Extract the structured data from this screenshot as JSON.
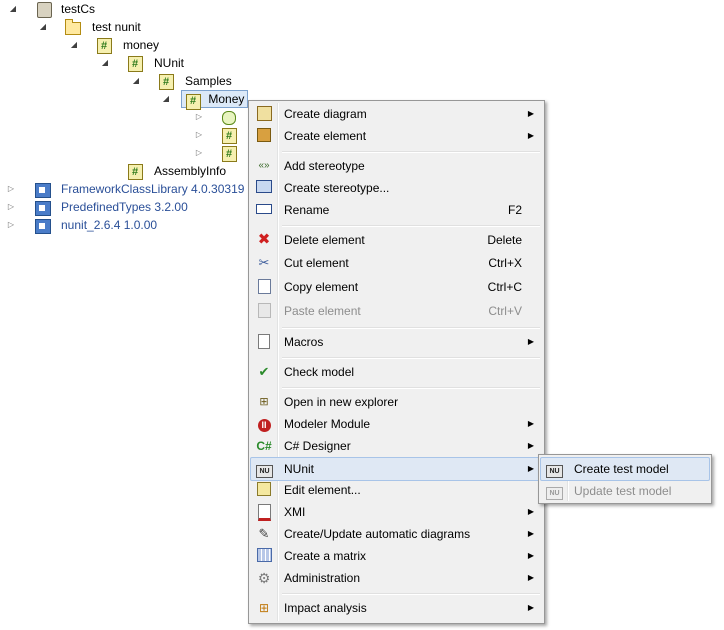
{
  "tree": [
    {
      "label": "testCs",
      "icon": "project-icon",
      "expander": "open"
    },
    {
      "label": "test nunit",
      "icon": "package-icon",
      "expander": "open"
    },
    {
      "label": "money",
      "icon": "cs-file-icon",
      "expander": "open"
    },
    {
      "label": "NUnit",
      "icon": "cs-file-icon",
      "expander": "open"
    },
    {
      "label": "Samples",
      "icon": "cs-file-icon",
      "expander": "open"
    },
    {
      "label": "Money",
      "icon": "cs-file-icon",
      "expander": "open",
      "selected": true
    },
    {
      "label": "",
      "icon": "class-icon",
      "expander": "closed"
    },
    {
      "label": "",
      "icon": "cs-file-icon",
      "expander": "closed"
    },
    {
      "label": "",
      "icon": "cs-file-icon",
      "expander": "closed"
    },
    {
      "label": "AssemblyInfo",
      "icon": "cs-file-icon",
      "expander": "none"
    },
    {
      "label": "FrameworkClassLibrary 4.0.30319",
      "icon": "assembly-icon",
      "expander": "closed"
    },
    {
      "label": "PredefinedTypes 3.2.00",
      "icon": "assembly-icon",
      "expander": "closed"
    },
    {
      "label": "nunit_2.6.4 1.0.00",
      "icon": "assembly-icon",
      "expander": "closed"
    }
  ],
  "context_menu": {
    "items": [
      {
        "label": "Create diagram",
        "submenu": true,
        "icon": "diagram-icon"
      },
      {
        "label": "Create element",
        "submenu": true,
        "icon": "element-icon"
      },
      {
        "label": "Add stereotype",
        "icon": "stereotype-icon"
      },
      {
        "label": "Create stereotype...",
        "icon": "stereotype-create-icon"
      },
      {
        "label": "Rename",
        "shortcut": "F2",
        "icon": "rename-icon"
      },
      {
        "label": "Delete element",
        "shortcut": "Delete",
        "icon": "delete-icon"
      },
      {
        "label": "Cut element",
        "shortcut": "Ctrl+X",
        "icon": "scissors-icon"
      },
      {
        "label": "Copy element",
        "shortcut": "Ctrl+C",
        "icon": "copy-icon"
      },
      {
        "label": "Paste element",
        "shortcut": "Ctrl+V",
        "disabled": true,
        "icon": "paste-icon"
      },
      {
        "label": "Macros",
        "submenu": true,
        "icon": "macro-icon"
      },
      {
        "label": "Check model",
        "icon": "check-icon"
      },
      {
        "label": "Open in new explorer",
        "icon": "explorer-icon"
      },
      {
        "label": "Modeler Module",
        "submenu": true,
        "icon": "module-icon"
      },
      {
        "label": "C# Designer",
        "submenu": true,
        "icon": "csharp-icon"
      },
      {
        "label": "NUnit",
        "submenu": true,
        "highlighted": true,
        "icon": "nunit-icon"
      },
      {
        "label": "Edit element...",
        "icon": "edit-icon"
      },
      {
        "label": "XMI",
        "submenu": true,
        "icon": "xmi-icon"
      },
      {
        "label": "Create/Update automatic diagrams",
        "submenu": true,
        "icon": "wand-icon"
      },
      {
        "label": "Create a matrix",
        "submenu": true,
        "icon": "matrix-icon"
      },
      {
        "label": "Administration",
        "submenu": true,
        "icon": "gear-icon"
      },
      {
        "label": "Impact analysis",
        "submenu": true,
        "icon": "impact-icon"
      }
    ]
  },
  "submenu": {
    "items": [
      {
        "label": "Create test model",
        "highlighted": true,
        "icon": "nunit-icon"
      },
      {
        "label": "Update test model",
        "disabled": true,
        "icon": "nunit-icon"
      }
    ],
    "icon_text": "NU"
  }
}
